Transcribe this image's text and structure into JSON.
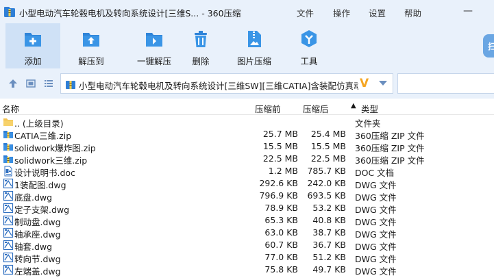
{
  "window": {
    "title": "小型电动汽车轮毂电机及转向系统设计[三维S... - 360压缩",
    "menu": [
      "文件",
      "操作",
      "设置",
      "帮助"
    ],
    "minimize": "—"
  },
  "toolbar": {
    "items": [
      {
        "label": "添加",
        "icon": "add-icon"
      },
      {
        "label": "解压到",
        "icon": "extract-to-icon"
      },
      {
        "label": "一键解压",
        "icon": "one-click-extract-icon"
      },
      {
        "label": "删除",
        "icon": "trash-icon"
      },
      {
        "label": "图片压缩",
        "icon": "image-compress-icon"
      },
      {
        "label": "工具",
        "icon": "tools-icon"
      }
    ],
    "side_badge": "扫"
  },
  "pathbar": {
    "path": "小型电动汽车轮毂电机及转向系统设计[三维SW][三维CATIA]含装配仿真动画"
  },
  "columns": {
    "name": "名称",
    "size": "压缩前",
    "packed": "压缩后",
    "type": "类型",
    "sort_indicator": "▲"
  },
  "files": [
    {
      "name": ".. (上级目录)",
      "size": "",
      "packed": "",
      "type": "文件夹",
      "icon": "folder-icon"
    },
    {
      "name": "CATIA三维.zip",
      "size": "25.7 MB",
      "packed": "25.4 MB",
      "type": "360压缩 ZIP 文件",
      "icon": "zip-icon"
    },
    {
      "name": "solidwork爆炸图.zip",
      "size": "15.5 MB",
      "packed": "15.5 MB",
      "type": "360压缩 ZIP 文件",
      "icon": "zip-icon"
    },
    {
      "name": "solidwork三维.zip",
      "size": "22.5 MB",
      "packed": "22.5 MB",
      "type": "360压缩 ZIP 文件",
      "icon": "zip-icon"
    },
    {
      "name": "设计说明书.doc",
      "size": "1.2 MB",
      "packed": "785.7 KB",
      "type": "DOC 文档",
      "icon": "doc-icon"
    },
    {
      "name": "1装配图.dwg",
      "size": "292.6 KB",
      "packed": "242.0 KB",
      "type": "DWG 文件",
      "icon": "dwg-icon"
    },
    {
      "name": "底盘.dwg",
      "size": "796.9 KB",
      "packed": "693.5 KB",
      "type": "DWG 文件",
      "icon": "dwg-icon"
    },
    {
      "name": "定子支架.dwg",
      "size": "78.9 KB",
      "packed": "53.2 KB",
      "type": "DWG 文件",
      "icon": "dwg-icon"
    },
    {
      "name": "制动盘.dwg",
      "size": "65.3 KB",
      "packed": "40.8 KB",
      "type": "DWG 文件",
      "icon": "dwg-icon"
    },
    {
      "name": "轴承座.dwg",
      "size": "63.0 KB",
      "packed": "38.7 KB",
      "type": "DWG 文件",
      "icon": "dwg-icon"
    },
    {
      "name": "轴套.dwg",
      "size": "60.7 KB",
      "packed": "36.7 KB",
      "type": "DWG 文件",
      "icon": "dwg-icon"
    },
    {
      "name": "转向节.dwg",
      "size": "77.0 KB",
      "packed": "51.2 KB",
      "type": "DWG 文件",
      "icon": "dwg-icon"
    },
    {
      "name": "左端盖.dwg",
      "size": "75.8 KB",
      "packed": "49.7 KB",
      "type": "DWG 文件",
      "icon": "dwg-icon"
    }
  ]
}
